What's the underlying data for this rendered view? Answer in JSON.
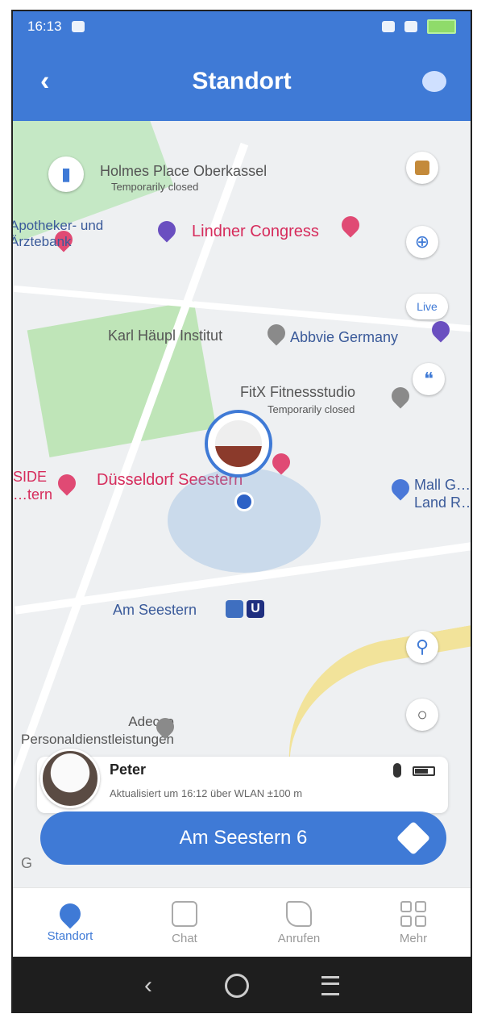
{
  "status_bar": {
    "time": "16:13"
  },
  "app_bar": {
    "title": "Standort",
    "back_icon": "back-arrow-icon",
    "chat_icon": "chat-bubble-icon"
  },
  "map": {
    "pois": [
      {
        "text": "Holmes Place Oberkassel",
        "style": "gray"
      },
      {
        "text": "Temporarily closed",
        "style": "gray"
      },
      {
        "text": "Apotheker- und Ärztebank",
        "style": "blue"
      },
      {
        "text": "Lindner Congress",
        "style": "red"
      },
      {
        "text": "Karl Häupl Institut",
        "style": "gray"
      },
      {
        "text": "Abbvie Germany",
        "style": "blue"
      },
      {
        "text": "FitX Fitnessstudio",
        "style": "gray"
      },
      {
        "text": "Temporarily closed",
        "style": "gray"
      },
      {
        "text": "Düsseldorf Seestern",
        "style": "red"
      },
      {
        "text": "Mall G… Land R…",
        "style": "blue"
      },
      {
        "text": "Am Seestern",
        "style": "blue"
      },
      {
        "text": "Adecco Personaldienstleistungen",
        "style": "gray"
      },
      {
        "text": "SIDE …tern",
        "style": "red"
      }
    ],
    "live_label": "Live",
    "google_mark": "G"
  },
  "person": {
    "name": "Peter",
    "status": "Aktualisiert um 16:12 über WLAN ±100 m",
    "address": "Am Seestern 6"
  },
  "bottom_nav": [
    {
      "label": "Standort",
      "icon": "location-pin-icon",
      "active": true
    },
    {
      "label": "Chat",
      "icon": "chat-icon",
      "active": false
    },
    {
      "label": "Anrufen",
      "icon": "phone-icon",
      "active": false
    },
    {
      "label": "Mehr",
      "icon": "grid-icon",
      "active": false
    }
  ],
  "colors": {
    "accent": "#3f7ad6",
    "poi_red": "#d62c5c"
  }
}
